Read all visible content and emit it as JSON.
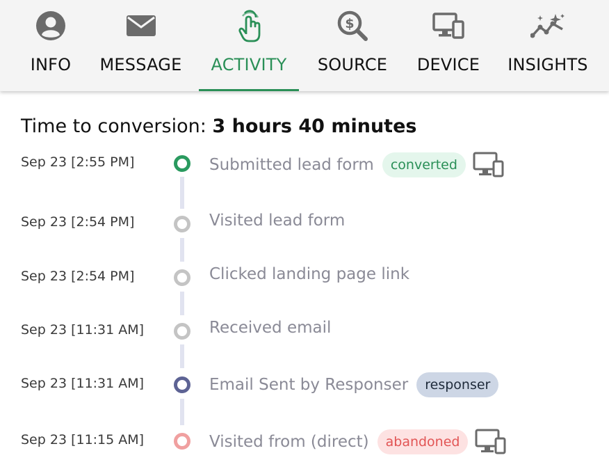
{
  "tabs": [
    {
      "label": "INFO",
      "icon": "user-circle-icon",
      "active": false
    },
    {
      "label": "MESSAGE",
      "icon": "envelope-icon",
      "active": false
    },
    {
      "label": "ACTIVITY",
      "icon": "pointer-hand-icon",
      "active": true
    },
    {
      "label": "SOURCE",
      "icon": "dollar-search-icon",
      "active": false
    },
    {
      "label": "DEVICE",
      "icon": "desktop-mobile-icon",
      "active": false
    },
    {
      "label": "INSIGHTS",
      "icon": "sparkle-chart-icon",
      "active": false
    }
  ],
  "conversion": {
    "label": "Time to conversion:",
    "value": "3 hours 40 minutes"
  },
  "events": [
    {
      "time": "Sep 23 [2:55 PM]",
      "label": "Submitted lead form",
      "badge": "converted",
      "status": "green",
      "device_icon": "desktop-mobile-icon"
    },
    {
      "time": "Sep 23 [2:54 PM]",
      "label": "Visited lead form",
      "status": "gray"
    },
    {
      "time": "Sep 23 [2:54 PM]",
      "label": "Clicked landing page link",
      "status": "gray"
    },
    {
      "time": "Sep 23 [11:31 AM]",
      "label": "Received email",
      "status": "gray"
    },
    {
      "time": "Sep 23 [11:31 AM]",
      "label": "Email Sent by Responser",
      "badge": "responser",
      "status": "navy"
    },
    {
      "time": "Sep 23 [11:15 AM]",
      "label": "Visited from (direct)",
      "badge": "abandoned",
      "status": "pink",
      "device_icon": "desktop-mobile-icon"
    }
  ],
  "colors": {
    "accent": "#2a8f57",
    "icon_gray": "#6b6b6b",
    "timeline_line": "#e1e3f0",
    "converted_bg": "#e4f6ec",
    "responser_bg": "#cdd6e5",
    "abandoned_bg": "#fde2e2",
    "abandoned_text": "#e25555"
  }
}
